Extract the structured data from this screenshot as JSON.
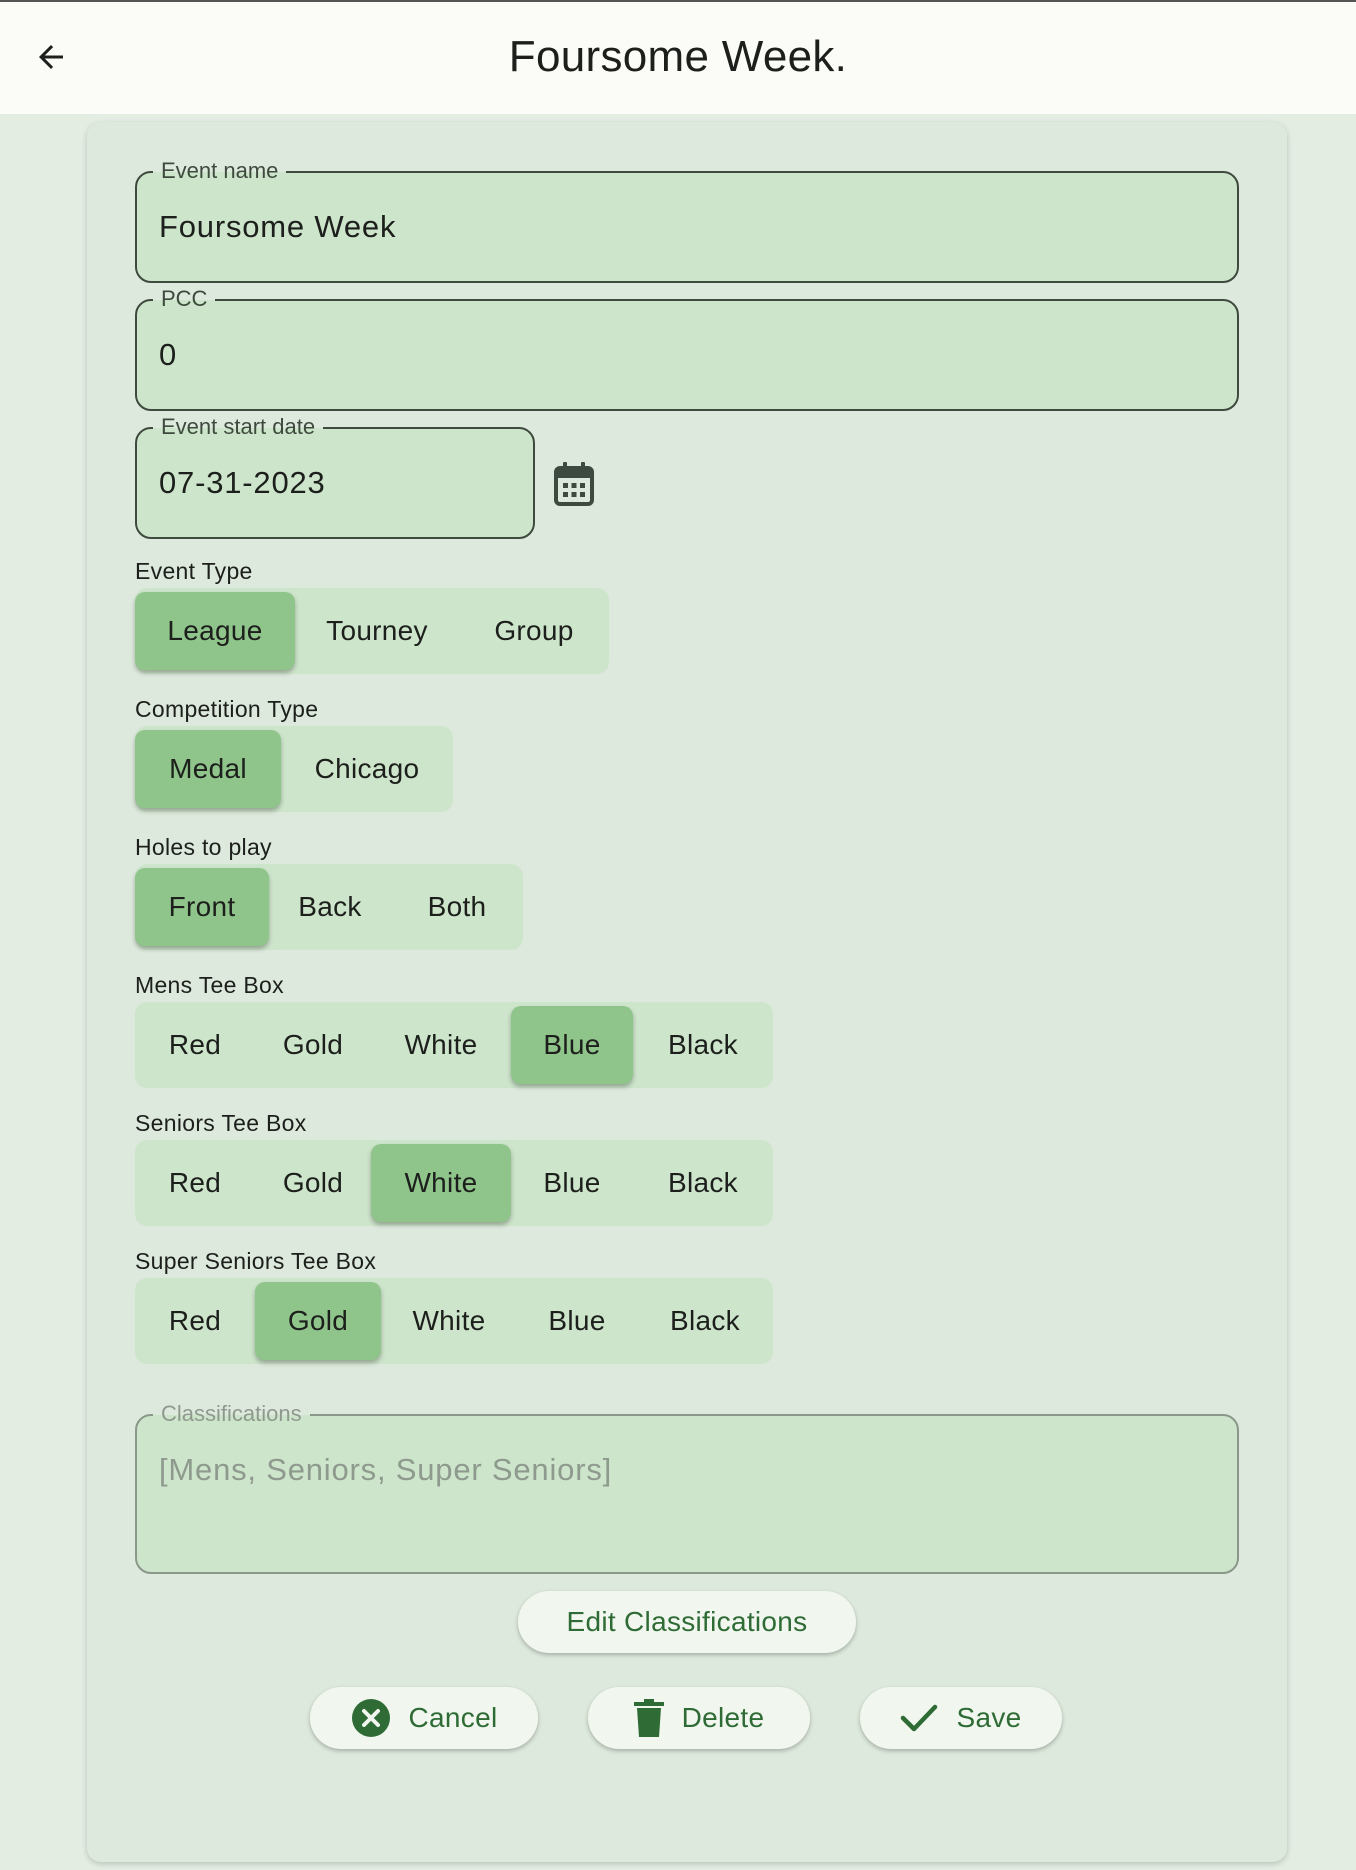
{
  "appbar": {
    "title": "Foursome Week.",
    "back_icon": "arrow-back-icon"
  },
  "form": {
    "event_name": {
      "label": "Event name",
      "value": "Foursome Week"
    },
    "pcc": {
      "label": "PCC",
      "value": "0"
    },
    "start_date": {
      "label": "Event start date",
      "value": "07-31-2023",
      "icon": "calendar-icon"
    },
    "event_type": {
      "label": "Event Type",
      "options": [
        "League",
        "Tourney",
        "Group"
      ],
      "selected": "League"
    },
    "competition_type": {
      "label": "Competition Type",
      "options": [
        "Medal",
        "Chicago"
      ],
      "selected": "Medal"
    },
    "holes": {
      "label": "Holes to play",
      "options": [
        "Front",
        "Back",
        "Both"
      ],
      "selected": "Front"
    },
    "mens_tee": {
      "label": "Mens Tee Box",
      "options": [
        "Red",
        "Gold",
        "White",
        "Blue",
        "Black"
      ],
      "selected": "Blue"
    },
    "seniors_tee": {
      "label": "Seniors Tee Box",
      "options": [
        "Red",
        "Gold",
        "White",
        "Blue",
        "Black"
      ],
      "selected": "White"
    },
    "super_seniors_tee": {
      "label": "Super Seniors Tee Box",
      "options": [
        "Red",
        "Gold",
        "White",
        "Blue",
        "Black"
      ],
      "selected": "Gold"
    },
    "classifications": {
      "label": "Classifications",
      "value": "[Mens, Seniors, Super Seniors]"
    }
  },
  "actions": {
    "edit_classifications": "Edit Classifications",
    "cancel": {
      "label": "Cancel",
      "icon": "cancel-circle-icon"
    },
    "delete": {
      "label": "Delete",
      "icon": "trash-icon"
    },
    "save": {
      "label": "Save",
      "icon": "check-icon"
    }
  },
  "colors": {
    "background": "#e3ede2",
    "card": "#dde9dc",
    "field_fill": "#cde5cb",
    "selected_segment": "#8fc48a",
    "accent_text": "#2e6b35"
  }
}
